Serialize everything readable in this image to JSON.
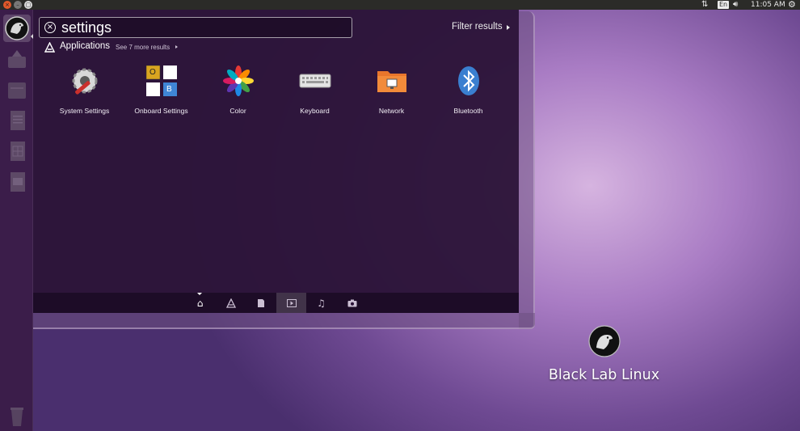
{
  "top_panel": {
    "language": "En",
    "clock": "11:05 AM"
  },
  "search": {
    "query": "settings",
    "filter_label": "Filter results"
  },
  "category": {
    "title": "Applications",
    "see_more": "See 7 more results"
  },
  "apps": [
    {
      "label": "System Settings",
      "icon": "system-settings-icon"
    },
    {
      "label": "Onboard Settings",
      "icon": "onboard-settings-icon"
    },
    {
      "label": "Color",
      "icon": "color-icon"
    },
    {
      "label": "Keyboard",
      "icon": "keyboard-icon"
    },
    {
      "label": "Network",
      "icon": "network-icon"
    },
    {
      "label": "Bluetooth",
      "icon": "bluetooth-icon"
    }
  ],
  "onboard_icon_letters": {
    "top_left": "O",
    "bottom_right": "B"
  },
  "lenses": [
    "home-lens",
    "applications-lens",
    "files-lens",
    "video-lens",
    "music-lens",
    "photos-lens"
  ],
  "desktop": {
    "label": "Black Lab Linux"
  },
  "colors": {
    "panel": "#2b2b28",
    "dash_bg": "#2c1438",
    "accent_close": "#e2582a"
  }
}
